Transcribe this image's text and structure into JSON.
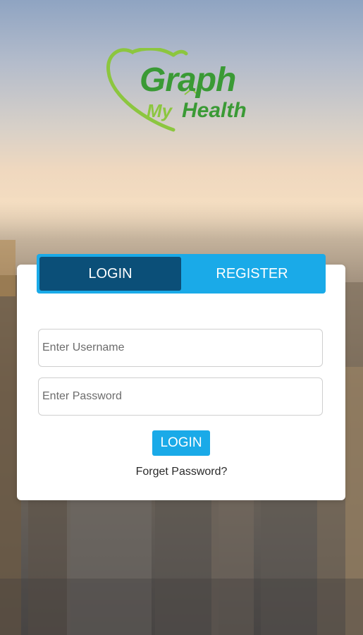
{
  "brand": {
    "line1": "Graph",
    "line2_a": "My",
    "line2_b": "Health",
    "color_primary": "#3a9a35",
    "color_secondary": "#8cc63f"
  },
  "tabs": {
    "login_label": "LOGIN",
    "register_label": "REGISTER",
    "active": "login"
  },
  "form": {
    "username_placeholder": "Enter Username",
    "username_value": "",
    "password_placeholder": "Enter Password",
    "password_value": "",
    "login_button": "LOGIN",
    "forgot_link": "Forget Password?"
  },
  "colors": {
    "accent": "#1aaae8",
    "active_tab": "#0b4f78"
  }
}
